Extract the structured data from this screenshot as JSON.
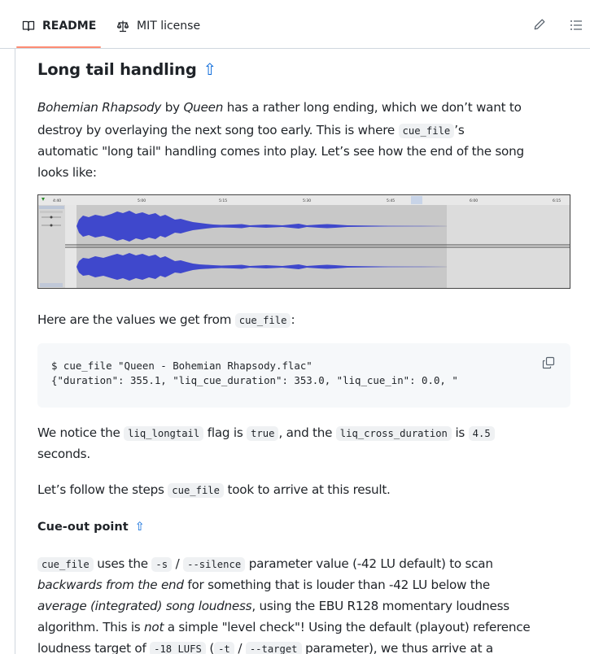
{
  "tabs": [
    {
      "label": "README",
      "icon": "book-icon",
      "active": true
    },
    {
      "label": "MIT license",
      "icon": "scale-icon",
      "active": false
    }
  ],
  "colors": {
    "accent": "#0969da",
    "tab_underline": "#fd8c73",
    "wave": "#3f48cc",
    "code_bg": "#eff1f3"
  },
  "section": {
    "title": "Long tail handling",
    "anchor": "⇧",
    "p1": {
      "l1_a": "Bohemian Rhapsody",
      "l1_b": " by ",
      "l1_c": "Queen",
      "l1_d": " has a rather long ending, which we don’t want to",
      "l2_a": "destroy by overlaying the next song too early. This is where ",
      "l2_code": "cue_file",
      "l2_b": "’s",
      "l3": "automatic \"long tail\" handling comes into play. Let’s see how the end of the song",
      "l4": "looks like:"
    },
    "waveform": {
      "ticks": [
        "4:40",
        "5:00",
        "5:15",
        "5:30",
        "5:45",
        "6:00",
        "6:15"
      ]
    },
    "p2": {
      "a": "Here are the values we get from ",
      "code": "cue_file",
      "b": ":"
    },
    "codeblock": {
      "line1": "$ cue_file \"Queen - Bohemian Rhapsody.flac\"",
      "line2": "{\"duration\": 355.1, \"liq_cue_duration\": 353.0, \"liq_cue_in\": 0.0, \""
    },
    "p3": {
      "a": "We notice the ",
      "c1": "liq_longtail",
      "b": " flag is ",
      "c2": "true",
      "c": ", and the ",
      "c3": "liq_cross_duration",
      "d": " is ",
      "c4": "4.5",
      "l2": "seconds."
    },
    "p4": {
      "a": "Let’s follow the steps ",
      "code": "cue_file",
      "b": " took to arrive at this result."
    }
  },
  "subsection": {
    "title": "Cue-out point",
    "anchor": "⇧",
    "p1": {
      "l1_c1": "cue_file",
      "l1_a": " uses the ",
      "l1_c2": "-s",
      "l1_b": " / ",
      "l1_c3": "--silence",
      "l1_c": " parameter value (-42 LU default) to scan",
      "l2_em": "backwards from the end",
      "l2_a": " for something that is louder than -42 LU below the",
      "l3_em": "average (integrated) song loudness",
      "l3_a": ", using the EBU R128 momentary loudness",
      "l4_a": "algorithm. This is ",
      "l4_em": "not",
      "l4_b": " a simple \"level check\"! Using the default (playout) reference",
      "l5_a": "loudness target of ",
      "l5_c1": "-18 LUFS",
      "l5_b": " (",
      "l5_c2": "-t",
      "l5_c": " / ",
      "l5_c3": "--target",
      "l5_d": " parameter), we thus arrive at a"
    }
  }
}
